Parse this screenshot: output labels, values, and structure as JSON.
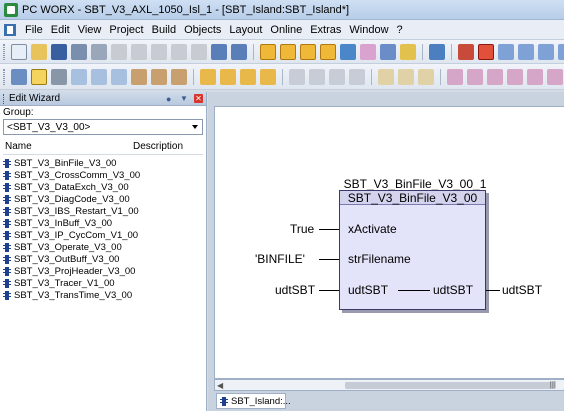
{
  "window": {
    "title": "PC WORX - SBT_V3_AXL_1050_Isl_1 - [SBT_Island:SBT_Island*]"
  },
  "menu": [
    "File",
    "Edit",
    "View",
    "Project",
    "Build",
    "Objects",
    "Layout",
    "Online",
    "Extras",
    "Window",
    "?"
  ],
  "panel": {
    "title": "Edit Wizard",
    "group_label": "Group:",
    "group_value": "<SBT_V3_V3_00>",
    "col_name": "Name",
    "col_desc": "Description",
    "items": [
      "SBT_V3_BinFile_V3_00",
      "SBT_V3_CrossComm_V3_00",
      "SBT_V3_DataExch_V3_00",
      "SBT_V3_DiagCode_V3_00",
      "SBT_V3_IBS_Restart_V1_00",
      "SBT_V3_InBuff_V3_00",
      "SBT_V3_IP_CycCom_V1_00",
      "SBT_V3_Operate_V3_00",
      "SBT_V3_OutBuff_V3_00",
      "SBT_V3_ProjHeader_V3_00",
      "SBT_V3_Tracer_V1_00",
      "SBT_V3_TransTime_V3_00"
    ]
  },
  "worksheet": {
    "tab_label": "SBT_Island:...",
    "fb": {
      "instance_name": "SBT_V3_BinFile_V3_00_1",
      "type_name": "SBT_V3_BinFile_V3_00",
      "inputs": [
        {
          "pin": "xActivate",
          "value": "True"
        },
        {
          "pin": "strFilename",
          "value": "'BINFILE'"
        },
        {
          "pin": "udtSBT",
          "value": "udtSBT"
        }
      ],
      "outputs": [
        {
          "pin": "udtSBT",
          "value": "udtSBT"
        }
      ]
    }
  }
}
